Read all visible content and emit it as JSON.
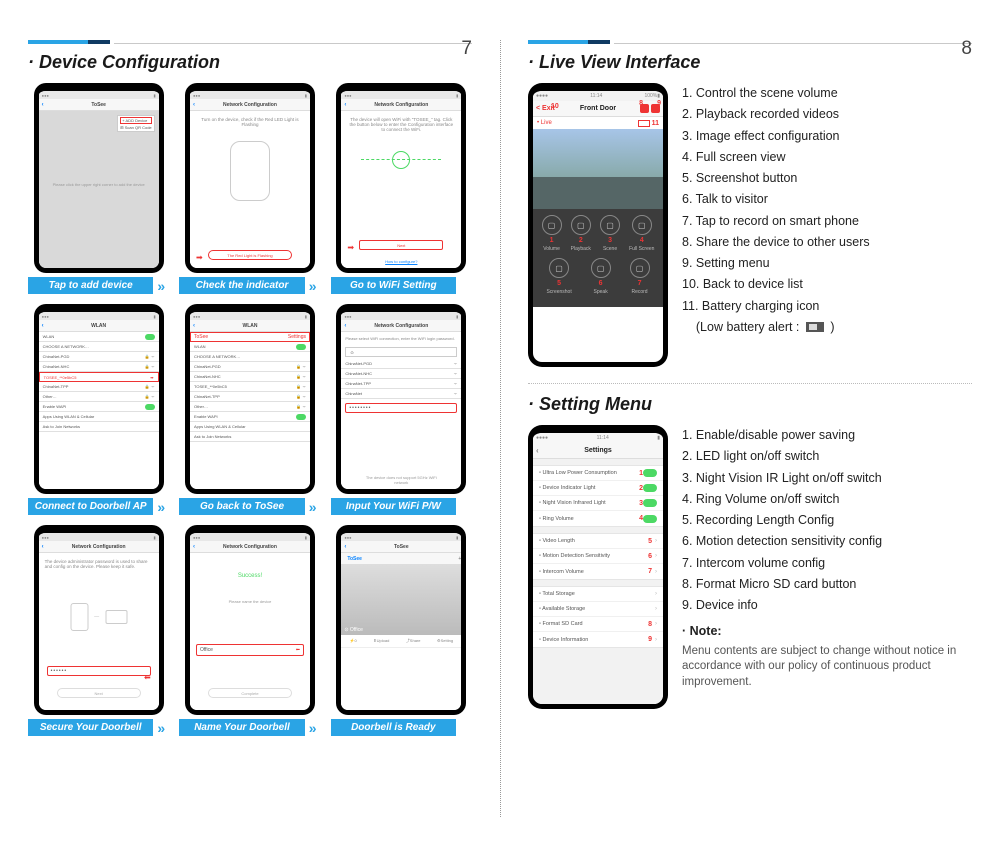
{
  "pageLeftNum": "7",
  "pageRightNum": "8",
  "left": {
    "title": "Device Configuration",
    "steps": [
      {
        "caption": "Tap to add device",
        "header": "ToSee",
        "menu": [
          "ADD Device",
          "Scan QR Code"
        ],
        "grey": true,
        "arrow": true
      },
      {
        "caption": "Check the indicator",
        "header": "Network Configuration",
        "msg": "Turn on the device, check if the Red LED Light is Flashing",
        "btn": "The Red Light is Flashing",
        "arrow": true
      },
      {
        "caption": "Go to WiFi Setting",
        "header": "Network Configuration",
        "msg": "The device will open WiFi with \"TOSEE_\" tag. Click the button below to enter the Configuration interface to connect the WiFi.",
        "btn": "Next",
        "arrow": false
      },
      {
        "caption": "Connect to Doorbell AP",
        "header": "WLAN",
        "wlan": true,
        "selRow": "TOSEE_**0e5bC5",
        "arrow": true
      },
      {
        "caption": "Go back to ToSee",
        "header": "WLAN",
        "wlan": true,
        "topSel": "ToSee",
        "arrow": true
      },
      {
        "caption": "Input Your WiFi P/W",
        "header": "Network Configuration",
        "pwlist": true,
        "arrow": false
      },
      {
        "caption": "Secure Your Doorbell",
        "header": "Network Configuration",
        "secure": true,
        "arrow": true
      },
      {
        "caption": "Name Your Doorbell",
        "header": "Network Configuration",
        "name": true,
        "arrow": true
      },
      {
        "caption": "Doorbell is Ready",
        "header": "ToSee",
        "ready": true,
        "arrow": false
      }
    ],
    "wlanRows": [
      "WLAN",
      "CHOOSE A NETWORK…",
      "ChinaNet-PGD",
      "ChinaNet-NHC",
      "TOSEE_**0e5bC5",
      "ChinaNet-TPP",
      "Other…",
      "Enable WAPI",
      "Apps Using WLAN & Cellular",
      "Ask to Join Networks"
    ],
    "pwNetRows": [
      "ChinaNet-PGD",
      "ChinaNet-NHC",
      "ChinaNet-TPP",
      "ChinaNet"
    ]
  },
  "right": {
    "live": {
      "title": "Live View Interface",
      "phoneTitle": "Front Door",
      "backLabel": "< Exit",
      "ctrlRow1": [
        "Volume",
        "Playback",
        "Scene",
        "Full Screen"
      ],
      "ctrlRow2": [
        "Screenshot",
        "Speak",
        "Record"
      ],
      "list": [
        "1. Control the scene volume",
        "2. Playback recorded videos",
        "3. Image effect configuration",
        "4. Full screen view",
        "5. Screenshot button",
        "6. Talk to visitor",
        "7. Tap to record  on smart phone",
        "8. Share the device to other users",
        "9. Setting menu",
        "10. Back to device list",
        "11. Battery charging icon"
      ],
      "lowBatt": "(Low battery alert :",
      "lowBattEnd": ")"
    },
    "settings": {
      "title": "Setting Menu",
      "phoneTitle": "Settings",
      "rowsA": [
        {
          "label": "Ultra Low Power Consumption",
          "n": "1"
        },
        {
          "label": "Device Indicator Light",
          "n": "2"
        },
        {
          "label": "Night Vision Infrared Light",
          "n": "3"
        },
        {
          "label": "Ring Volume",
          "n": "4"
        }
      ],
      "rowsB": [
        {
          "label": "Video Length",
          "n": "5"
        },
        {
          "label": "Motion Detection Sensitivity",
          "n": "6"
        },
        {
          "label": "Intercom Volume",
          "n": "7"
        }
      ],
      "rowsC": [
        {
          "label": "Total Storage",
          "n": ""
        },
        {
          "label": "Available Storage",
          "n": ""
        },
        {
          "label": "Format SD Card",
          "n": "8"
        },
        {
          "label": "Device Information",
          "n": "9"
        }
      ],
      "list": [
        "1. Enable/disable power saving",
        "2. LED light on/off switch",
        "3. Night Vision IR Light on/off switch",
        "4. Ring Volume on/off switch",
        "5. Recording Length Config",
        "6. Motion detection sensitivity config",
        "7. Intercom volume config",
        "8. Format Micro SD card button",
        "9. Device info"
      ],
      "noteHd": "Note:",
      "noteTx": "Menu contents are subject to change without notice in accordance with our policy of continuous product improvement."
    }
  }
}
